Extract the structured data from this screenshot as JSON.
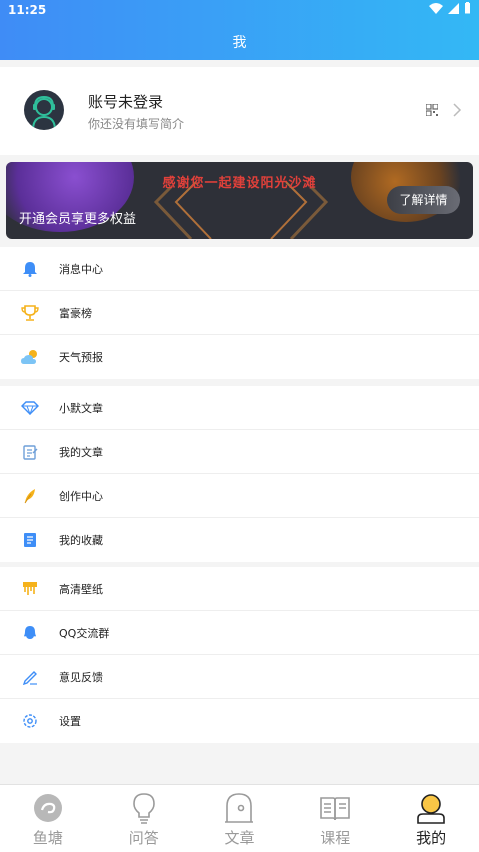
{
  "status_bar": {
    "time": "11:25"
  },
  "header": {
    "title": "我"
  },
  "profile": {
    "name": "账号未登录",
    "subtitle": "你还没有填写简介"
  },
  "banner": {
    "title": "感谢您一起建设阳光沙滩",
    "subtitle": "开通会员享更多权益",
    "button_label": "了解详情"
  },
  "menu_groups": [
    {
      "items": [
        {
          "label": "消息中心",
          "icon": "bell-icon"
        },
        {
          "label": "富豪榜",
          "icon": "trophy-icon"
        },
        {
          "label": "天气预报",
          "icon": "weather-icon"
        }
      ]
    },
    {
      "items": [
        {
          "label": "小默文章",
          "icon": "diamond-icon"
        },
        {
          "label": "我的文章",
          "icon": "notes-icon"
        },
        {
          "label": "创作中心",
          "icon": "feather-icon"
        },
        {
          "label": "我的收藏",
          "icon": "bookmark-list-icon"
        }
      ]
    },
    {
      "items": [
        {
          "label": "高清壁纸",
          "icon": "wallpaper-icon"
        },
        {
          "label": "QQ交流群",
          "icon": "qq-icon"
        },
        {
          "label": "意见反馈",
          "icon": "pen-icon"
        },
        {
          "label": "设置",
          "icon": "gear-icon"
        }
      ]
    }
  ],
  "tabbar": {
    "tabs": [
      {
        "label": "鱼塘",
        "icon": "fishpond-icon"
      },
      {
        "label": "问答",
        "icon": "lightbulb-icon"
      },
      {
        "label": "文章",
        "icon": "article-icon"
      },
      {
        "label": "课程",
        "icon": "book-icon"
      },
      {
        "label": "我的",
        "icon": "profile-icon"
      }
    ],
    "active": "我的"
  },
  "colors": {
    "header_start": "#3f8cf6",
    "header_end": "#33b8f5",
    "banner_title": "#e0403a",
    "menu_icon_blue": "#3e8ef7",
    "menu_icon_yellow": "#f5b21b"
  }
}
